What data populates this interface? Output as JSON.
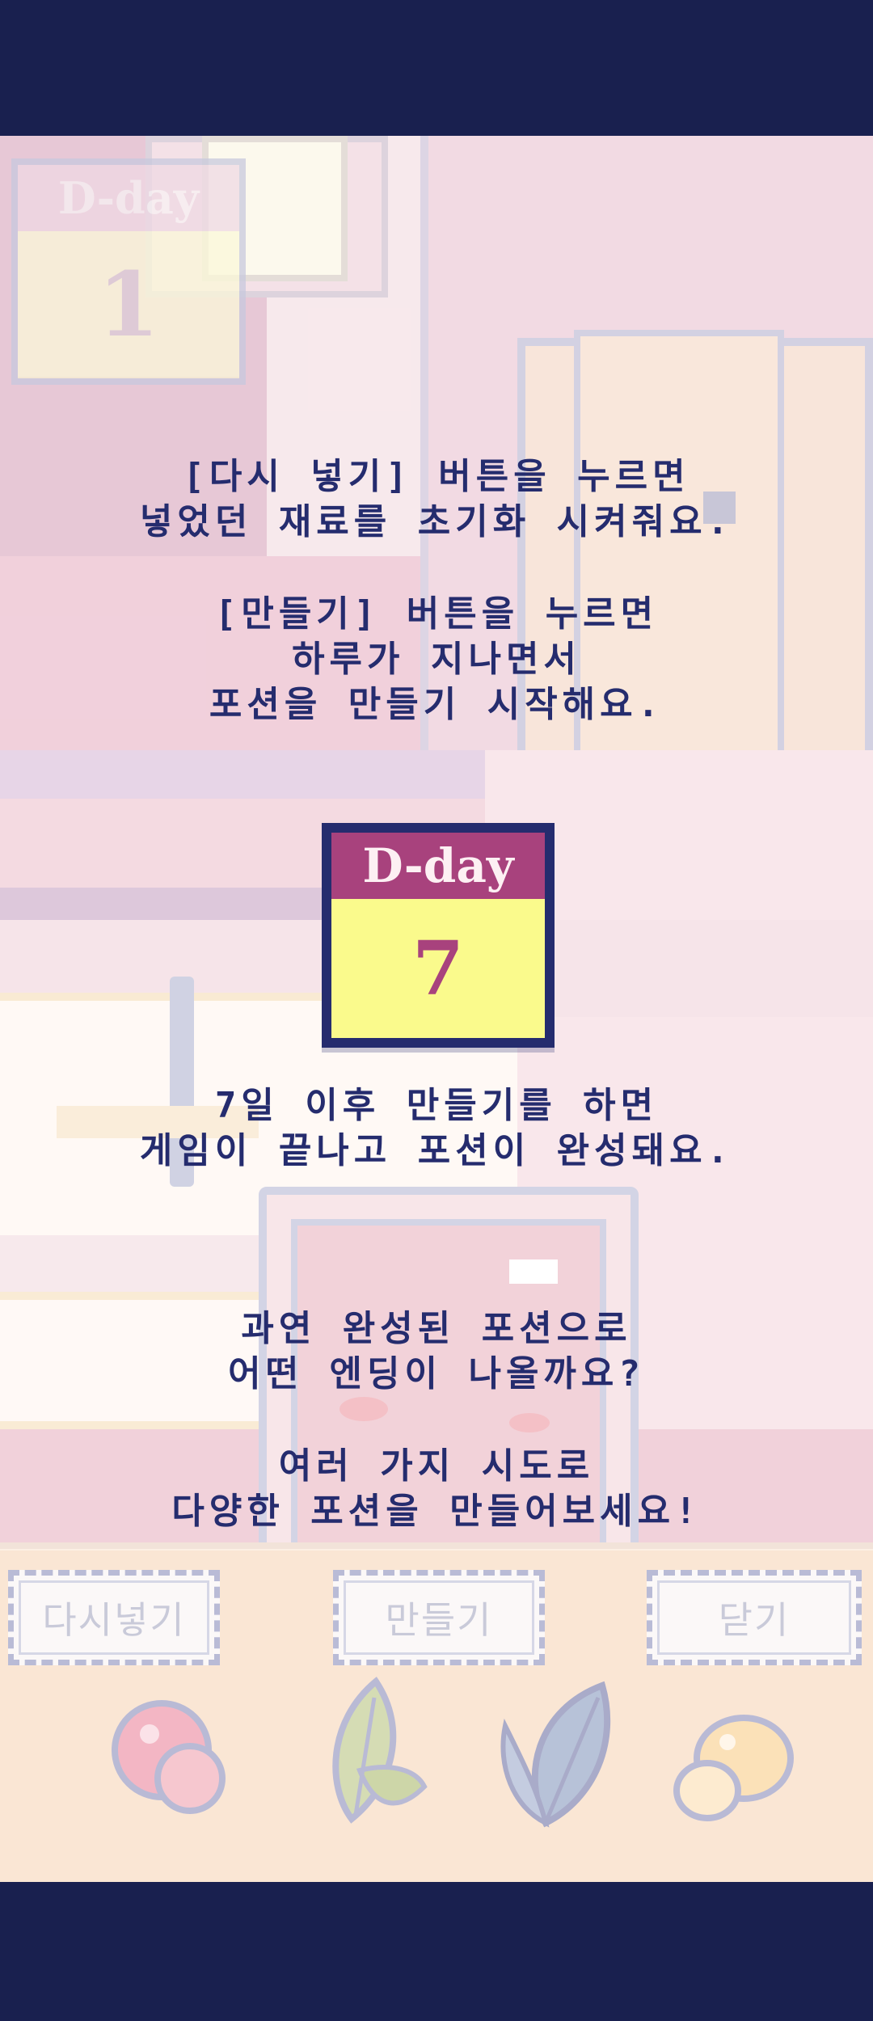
{
  "background_calendar": {
    "header": "D-day",
    "day": "1"
  },
  "tutorial_paragraph_1": "[다시 넣기] 버튼을 누르면\n넣었던 재료를 초기화 시켜줘요.",
  "tutorial_paragraph_2": "[만들기] 버튼을 누르면\n하루가 지나면서\n포션을 만들기 시작해요.",
  "highlight_calendar": {
    "header": "D-day",
    "day": "7"
  },
  "tutorial_paragraph_3": "7일 이후 만들기를 하면\n게임이 끝나고 포션이 완성돼요.",
  "tutorial_paragraph_4": "과연 완성된 포션으로\n어떤 엔딩이 나올까요?",
  "tutorial_paragraph_5": "여러 가지 시도로\n다양한 포션을 만들어보세요!",
  "buttons": {
    "reset": "다시넣기",
    "make": "만들기",
    "close": "닫기"
  },
  "ingredients": [
    "berry-icon",
    "green-leaf-icon",
    "blue-leaf-icon",
    "egg-icon"
  ],
  "colors": {
    "frame": "#19204f",
    "text": "#252c6e",
    "calendar_header": "#a8427d",
    "calendar_body": "#fafa8c"
  }
}
